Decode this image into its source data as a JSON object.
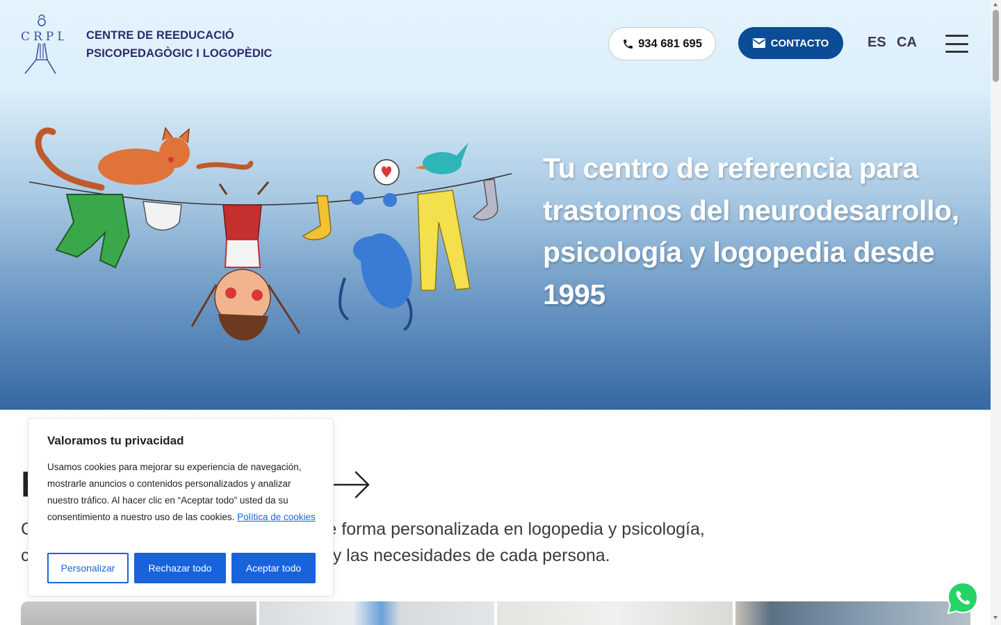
{
  "header": {
    "brand_line1": "CENTRE DE REEDUCACIÓ",
    "brand_line2": "PSICOPEDAGÒGIC I LOGOPÈDIC",
    "logo_text": "CRPL",
    "phone_label": "934 681 695",
    "contact_label": "CONTACTO",
    "lang_es": "ES",
    "lang_ca": "CA"
  },
  "hero": {
    "headline": "Tu centro de referencia para trastornos del neurodesarrollo, psicología y logopedia desde 1995"
  },
  "main": {
    "section_title_visible": "N",
    "intro_line1": "C                                            e hibrida de forma personalizada en logopedia y psicología,",
    "intro_line2": "c                                            ad, el ritmo y las necesidades de cada persona."
  },
  "cookie": {
    "title": "Valoramos tu privacidad",
    "body": "Usamos cookies para mejorar su experiencia de navegación, mostrarle anuncios o contenidos personalizados y analizar nuestro tráfico. Al hacer clic en “Aceptar todo” usted da su consentimiento a nuestro uso de las cookies.",
    "policy_link": "Política de cookies",
    "btn_customize": "Personalizar",
    "btn_reject": "Rechazar todo",
    "btn_accept": "Aceptar todo"
  },
  "colors": {
    "brand_navy": "#2c2a6e",
    "contact_blue": "#0a4c96",
    "cookie_blue": "#1863dc",
    "whatsapp_green": "#25d366"
  },
  "icons": [
    "phone-icon",
    "mail-icon",
    "menu-icon",
    "arrow-right-icon",
    "whatsapp-icon"
  ]
}
